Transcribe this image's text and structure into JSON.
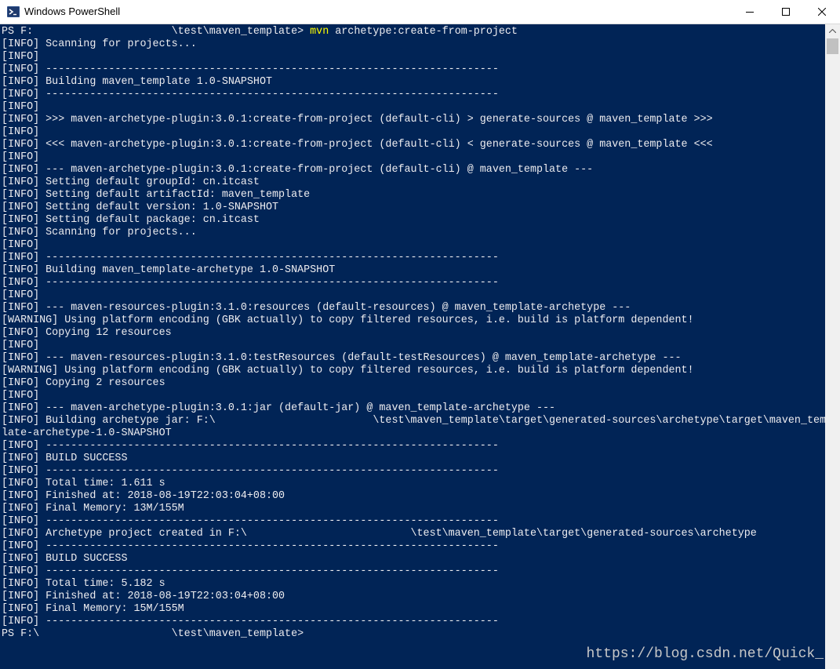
{
  "window": {
    "title": "Windows PowerShell",
    "icon": "powershell-icon",
    "controls": [
      "minimize-icon",
      "maximize-icon",
      "close-icon"
    ]
  },
  "colors": {
    "console_background": "#012456",
    "console_text": "#eeedf0",
    "command_highlight": "#fefe00"
  },
  "command": {
    "prompt": "PS F:                      \\test\\maven_template> ",
    "keyword": "mvn",
    "args": " archetype:create-from-project"
  },
  "lines": [
    "[INFO] Scanning for projects...",
    "[INFO]",
    "[INFO] ------------------------------------------------------------------------",
    "[INFO] Building maven_template 1.0-SNAPSHOT",
    "[INFO] ------------------------------------------------------------------------",
    "[INFO]",
    "[INFO] >>> maven-archetype-plugin:3.0.1:create-from-project (default-cli) > generate-sources @ maven_template >>>",
    "[INFO]",
    "[INFO] <<< maven-archetype-plugin:3.0.1:create-from-project (default-cli) < generate-sources @ maven_template <<<",
    "[INFO]",
    "[INFO] --- maven-archetype-plugin:3.0.1:create-from-project (default-cli) @ maven_template ---",
    "[INFO] Setting default groupId: cn.itcast",
    "[INFO] Setting default artifactId: maven_template",
    "[INFO] Setting default version: 1.0-SNAPSHOT",
    "[INFO] Setting default package: cn.itcast",
    "[INFO] Scanning for projects...",
    "[INFO]",
    "[INFO] ------------------------------------------------------------------------",
    "[INFO] Building maven_template-archetype 1.0-SNAPSHOT",
    "[INFO] ------------------------------------------------------------------------",
    "[INFO]",
    "[INFO] --- maven-resources-plugin:3.1.0:resources (default-resources) @ maven_template-archetype ---",
    "[WARNING] Using platform encoding (GBK actually) to copy filtered resources, i.e. build is platform dependent!",
    "[INFO] Copying 12 resources",
    "[INFO]",
    "[INFO] --- maven-resources-plugin:3.1.0:testResources (default-testResources) @ maven_template-archetype ---",
    "[WARNING] Using platform encoding (GBK actually) to copy filtered resources, i.e. build is platform dependent!",
    "[INFO] Copying 2 resources",
    "[INFO]",
    "[INFO] --- maven-archetype-plugin:3.0.1:jar (default-jar) @ maven_template-archetype ---",
    "[INFO] Building archetype jar: F:\\                         \\test\\maven_template\\target\\generated-sources\\archetype\\target\\maven_temp",
    "late-archetype-1.0-SNAPSHOT",
    "[INFO] ------------------------------------------------------------------------",
    "[INFO] BUILD SUCCESS",
    "[INFO] ------------------------------------------------------------------------",
    "[INFO] Total time: 1.611 s",
    "[INFO] Finished at: 2018-08-19T22:03:04+08:00",
    "[INFO] Final Memory: 13M/155M",
    "[INFO] ------------------------------------------------------------------------",
    "[INFO] Archetype project created in F:\\                          \\test\\maven_template\\target\\generated-sources\\archetype",
    "[INFO] ------------------------------------------------------------------------",
    "[INFO] BUILD SUCCESS",
    "[INFO] ------------------------------------------------------------------------",
    "[INFO] Total time: 5.182 s",
    "[INFO] Finished at: 2018-08-19T22:03:04+08:00",
    "[INFO] Final Memory: 15M/155M",
    "[INFO] ------------------------------------------------------------------------",
    "PS F:\\                     \\test\\maven_template>"
  ],
  "watermark": "https://blog.csdn.net/Quick_"
}
